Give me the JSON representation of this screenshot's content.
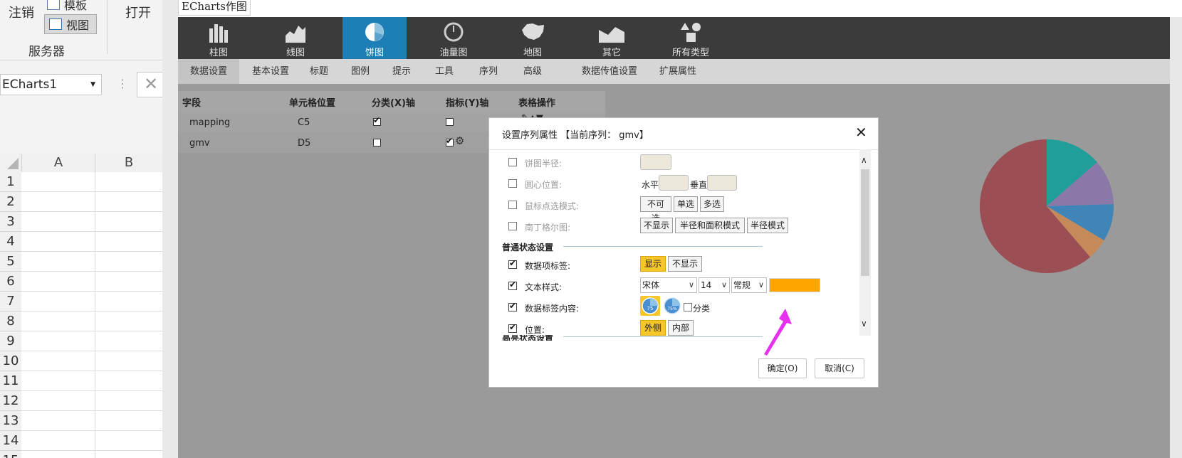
{
  "excel": {
    "ribbon": {
      "undo": "注销",
      "template": "模板",
      "view": "视图",
      "open": "打开",
      "server_group": "服务器"
    },
    "name_box": "ECharts1",
    "columns": [
      "A",
      "B"
    ],
    "rows": [
      "1",
      "2",
      "3",
      "4",
      "5",
      "6",
      "7",
      "8",
      "9",
      "10",
      "11",
      "12",
      "13",
      "14",
      "15"
    ]
  },
  "window": {
    "title": "ECharts作图",
    "chart_types": [
      {
        "label": "柱图",
        "icon": "bar-chart-icon"
      },
      {
        "label": "线图",
        "icon": "line-chart-icon"
      },
      {
        "label": "饼图",
        "icon": "pie-chart-icon"
      },
      {
        "label": "油量图",
        "icon": "gauge-icon"
      },
      {
        "label": "地图",
        "icon": "map-icon"
      },
      {
        "label": "其它",
        "icon": "other-chart-icon"
      },
      {
        "label": "所有类型",
        "icon": "all-types-icon"
      }
    ],
    "active_chart_type": "饼图",
    "subtabs": [
      "数据设置",
      "基本设置",
      "标题",
      "图例",
      "提示",
      "工具",
      "序列",
      "高级",
      "数据传值设置",
      "扩展属性"
    ],
    "active_subtab": "数据设置",
    "field_table": {
      "headers": [
        "字段",
        "单元格位置",
        "分类(X)轴",
        "指标(Y)轴",
        "表格操作"
      ],
      "rows": [
        {
          "field": "mapping",
          "cell": "C5",
          "x_axis": true,
          "y_axis": false
        },
        {
          "field": "gmv",
          "cell": "D5",
          "x_axis": false,
          "y_axis": true
        }
      ]
    }
  },
  "dialog": {
    "title": "设置序列属性 【当前序列： gmv】",
    "pie_radius_label": "饼图半径:",
    "center_label": "圆心位置:",
    "center_h": "水平",
    "center_v": "垂直",
    "mouse_mode_label": "鼠标点选模式:",
    "mouse_mode_options": [
      "不可选",
      "单选",
      "多选"
    ],
    "nightingale_label": "南丁格尔图:",
    "nightingale_options": [
      "不显示",
      "半径和面积模式",
      "半径模式"
    ],
    "normal_section": "普通状态设置",
    "data_label_label": "数据项标签:",
    "data_label_options": [
      "显示",
      "不显示"
    ],
    "data_label_selected": "显示",
    "text_style_label": "文本样式:",
    "font": "宋体",
    "font_size": "14",
    "font_weight": "常规",
    "text_color": "#ffa500",
    "label_content_label": "数据标签内容:",
    "label_content_icons": [
      "75",
      "75%"
    ],
    "category_checkbox": "分类",
    "position_label": "位置:",
    "position_options": [
      "外侧",
      "内部"
    ],
    "position_selected": "外侧",
    "highlight_section": "高亮状态设置",
    "ok_button": "确定(O)",
    "cancel_button": "取消(C)"
  },
  "pie_preview": {
    "colors": [
      "#1f9e9a",
      "#8a78a9",
      "#3f85b7",
      "#c68a5a",
      "#9b4f55"
    ]
  },
  "accent_color": "#1d7fb5",
  "annotation_arrow_color": "#e830f0"
}
